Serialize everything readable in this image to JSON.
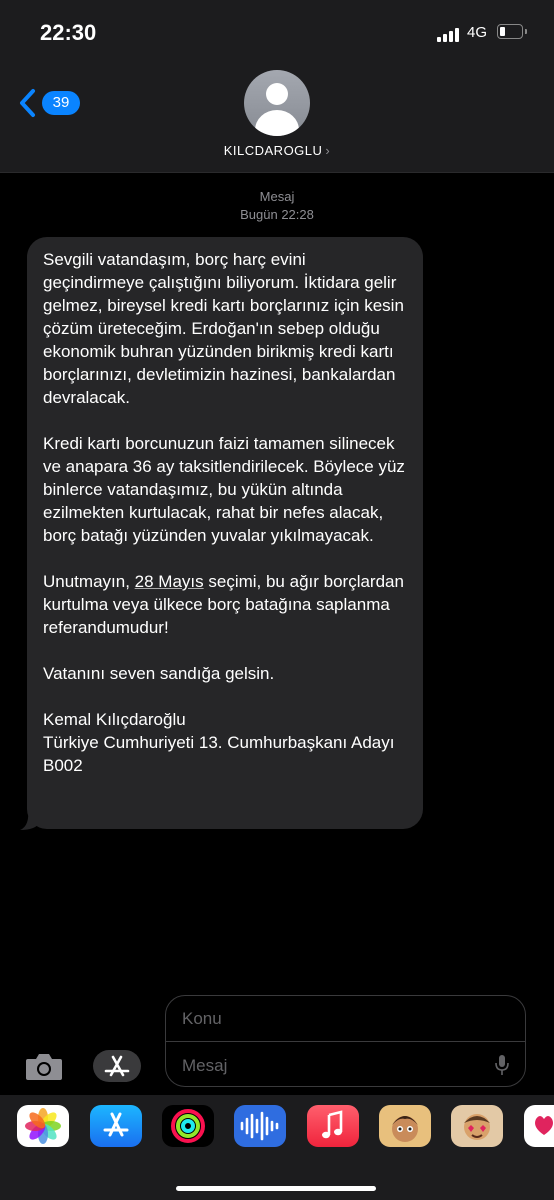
{
  "status_bar": {
    "time": "22:30",
    "network": "4G",
    "battery_level": 0.25
  },
  "header": {
    "unread_count": "39",
    "contact_name": "KILCDAROGLU",
    "contact_chevron": "›"
  },
  "thread": {
    "service_label": "Mesaj",
    "timestamp": "Bugün 22:28",
    "message": {
      "p1": "Sevgili vatandaşım, borç harç evini geçindirmeye çalıştığını biliyorum. İktidara gelir gelmez, bireysel kredi kartı borçlarınız için kesin çözüm üreteceğim. Erdoğan'ın sebep olduğu ekonomik buhran yüzünden birikmiş kredi kartı borçlarınızı, devletimizin hazinesi, bankalardan devralacak.",
      "p2": "Kredi kartı borcunuzun faizi tamamen silinecek ve anapara 36 ay taksitlendirilecek. Böylece yüz binlerce vatandaşımız, bu yükün altında ezilmekten kurtulacak, rahat bir nefes alacak, borç batağı yüzünden yuvalar yıkılmayacak.",
      "p3_before": "Unutmayın, ",
      "p3_link": "28 Mayıs",
      "p3_after": " seçimi, bu ağır borçlardan kurtulma veya ülkece borç batağına saplanma referandumudur!",
      "p4": "Vatanını seven sandığa gelsin.",
      "p5_line1": "Kemal Kılıçdaroğlu",
      "p5_line2": "Türkiye Cumhuriyeti 13. Cumhurbaşkanı Adayı B002"
    }
  },
  "composer": {
    "subject_placeholder": "Konu",
    "message_placeholder": "Mesaj"
  },
  "icons": {
    "back": "chevron-left-icon",
    "camera": "camera-icon",
    "app_store": "app-store-icon",
    "mic": "microphone-icon",
    "drawer": [
      "photos-app-icon",
      "app-store-app-icon",
      "activity-app-icon",
      "audio-message-app-icon",
      "music-app-icon",
      "memoji-app-icon",
      "memoji-stickers-app-icon",
      "digital-touch-app-icon"
    ]
  },
  "colors": {
    "accent": "#0a84ff",
    "bubble": "#262628",
    "header": "#1c1c1e"
  }
}
